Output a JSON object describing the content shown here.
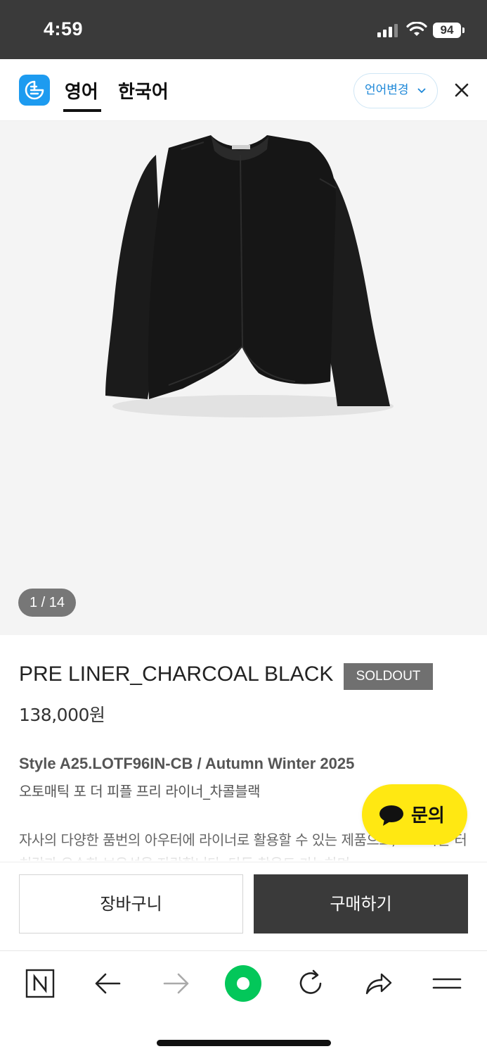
{
  "status_bar": {
    "time": "4:59",
    "battery": "94"
  },
  "translate_bar": {
    "tabs": [
      "영어",
      "한국어"
    ],
    "active_tab": "영어",
    "change_language_label": "언어변경"
  },
  "gallery": {
    "indicator": "1 / 14"
  },
  "product": {
    "name": "PRE LINER_CHARCOAL BLACK",
    "badge": "SOLDOUT",
    "price": "138,000원",
    "style_line": "Style A25.LOTF96IN-CB / Autumn Winter 2025",
    "korean_name": "오토매틱 포 더 피플 프리 라이너_차콜블랙",
    "description": "자사의 다양한 품번의 아우터에 라이너로 활용할 수 있는 제품으로, 보드라운 터치감과 우수한 보온성을 자랑합니다. 단독 착용도 가능하며"
  },
  "chat": {
    "label": "문의"
  },
  "purchase_bar": {
    "cart_label": "장바구니",
    "buy_label": "구매하기"
  },
  "browser_toolbar": {
    "icons": [
      "naver-home-icon",
      "back-arrow-icon",
      "forward-arrow-icon",
      "green-dot-icon",
      "refresh-icon",
      "share-icon",
      "menu-icon"
    ]
  },
  "colors": {
    "status_bar": "#3a3a3a",
    "accent_blue": "#1e88d8",
    "soldout_badge": "#707070",
    "buy_button": "#3a3a3a",
    "chat_yellow": "#ffe812",
    "naver_green": "#03c75a"
  }
}
